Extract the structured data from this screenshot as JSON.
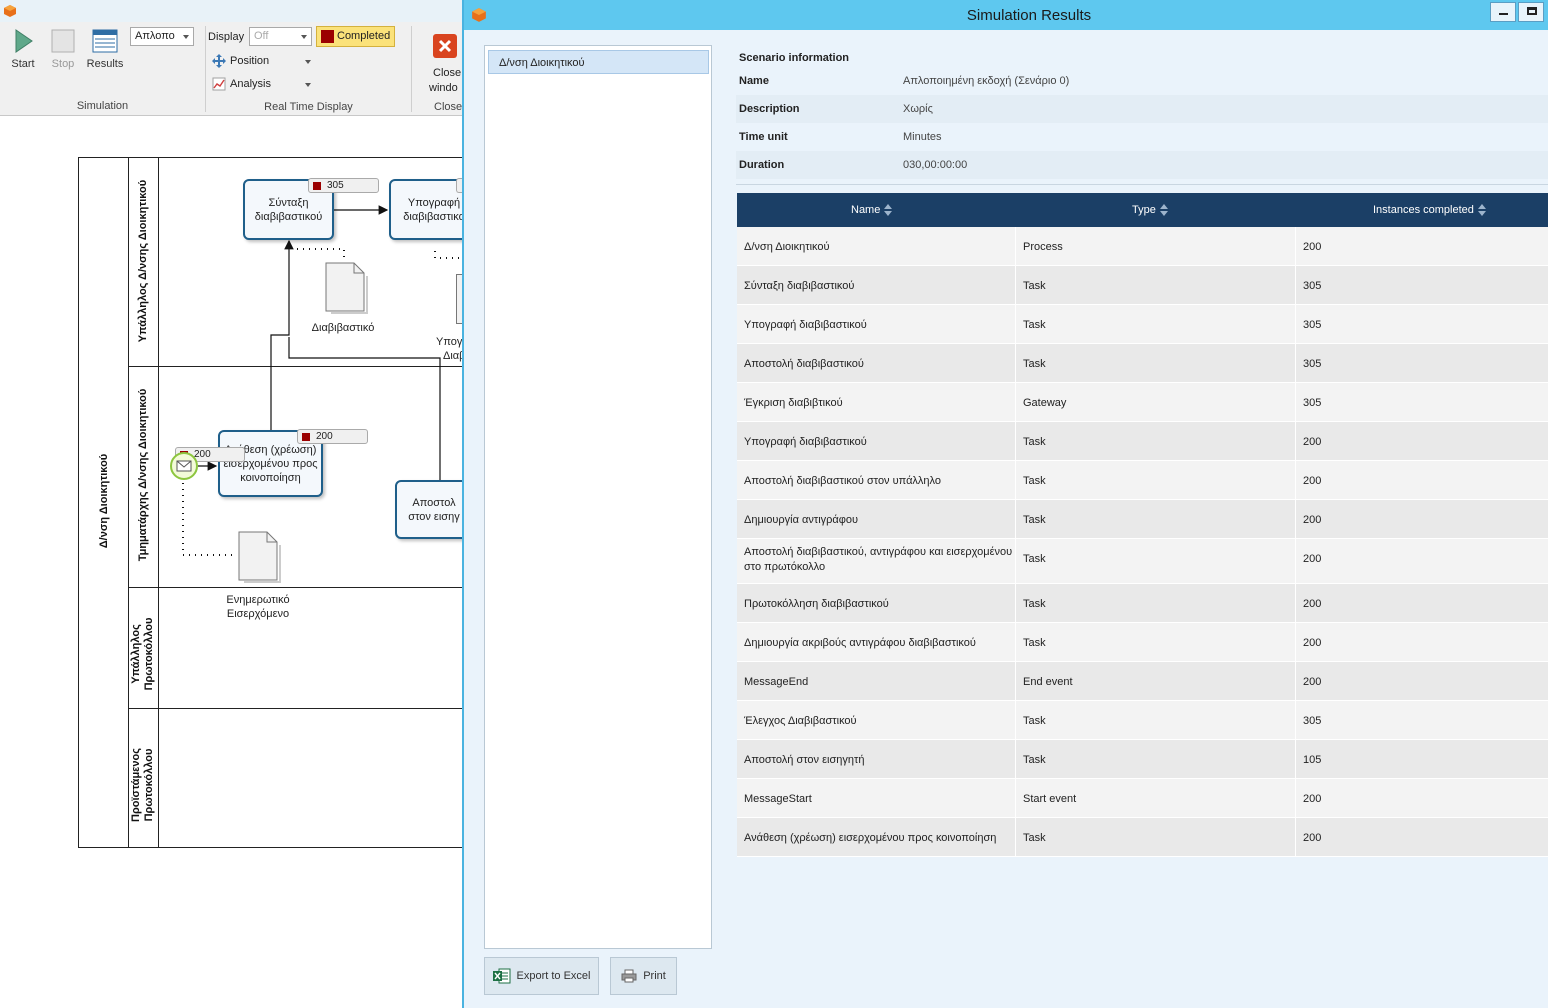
{
  "ribbon": {
    "start_label": "Start",
    "stop_label": "Stop",
    "results_label": "Results",
    "scenario_select": "Απλοπο",
    "display_label": "Display",
    "display_select": "Off",
    "completed_label": "Completed",
    "position_label": "Position",
    "analysis_label": "Analysis",
    "close_label_1": "Close",
    "close_label_2": "windo",
    "group_simulation": "Simulation",
    "group_realtime": "Real Time Display",
    "group_close": "Close"
  },
  "diagram": {
    "pool_label": "Δ/νση Διοικητικού",
    "lanes": [
      "Υπάλληλος Δ/νσης Διοικητικού",
      "Τμηματάρχης Δ/νσης Διοικητικού",
      "Υπάλληλος Πρωτοκόλλου",
      "Προϊστάμενος Πρωτοκόλλου"
    ],
    "tasks": {
      "t1": "Σύνταξη διαβιβαστικού",
      "t2": "Υπογραφή διαβιβαστικο",
      "t3": "Ανάθεση (χρέωση) εισερχομένου προς κοινοποίηση",
      "t4": "Αποστολ στον εισηγ"
    },
    "counters": {
      "c1": "305",
      "c2": "200",
      "c3": "200"
    },
    "docs": {
      "d1": "Διαβιβαστικό",
      "d2a": "Ενημερωτικό",
      "d2b": "Εισερχόμενο",
      "d3a": "Υπογ",
      "d3b": "Διαβ"
    }
  },
  "window": {
    "title": "Simulation Results",
    "tree_item": "Δ/νση Διοικητικού",
    "export_label": "Export to Excel",
    "print_label": "Print"
  },
  "scenario": {
    "title": "Scenario information",
    "rows": [
      {
        "key": "Name",
        "value": "Απλοποιημένη εκδοχή (Σενάριο 0)"
      },
      {
        "key": "Description",
        "value": "Χωρίς"
      },
      {
        "key": "Time unit",
        "value": "Minutes"
      },
      {
        "key": "Duration",
        "value": "030,00:00:00"
      }
    ]
  },
  "table": {
    "headers": [
      "Name",
      "Type",
      "Instances completed"
    ],
    "rows": [
      {
        "name": "Δ/νση Διοικητικού",
        "type": "Process",
        "count": "200"
      },
      {
        "name": "Σύνταξη διαβιβαστικού",
        "type": "Task",
        "count": "305"
      },
      {
        "name": "Υπογραφή διαβιβαστικού",
        "type": "Task",
        "count": "305"
      },
      {
        "name": "Αποστολή διαβιβαστικού",
        "type": "Task",
        "count": "305"
      },
      {
        "name": "Έγκριση διαβιβτικού",
        "type": "Gateway",
        "count": "305"
      },
      {
        "name": "Υπογραφή διαβιβαστικού",
        "type": "Task",
        "count": "200"
      },
      {
        "name": "Αποστολή διαβιβαστικού στον υπάλληλο",
        "type": "Task",
        "count": "200"
      },
      {
        "name": "Δημιουργία αντιγράφου",
        "type": "Task",
        "count": "200"
      },
      {
        "name": "Αποστολή διαβιβαστικού, αντιγράφου και εισερχομένου στο πρωτόκολλο",
        "type": "Task",
        "count": "200"
      },
      {
        "name": "Πρωτοκόλληση διαβιβαστικού",
        "type": "Task",
        "count": "200"
      },
      {
        "name": "Δημιουργία ακριβούς αντιγράφου διαβιβαστικού",
        "type": "Task",
        "count": "200"
      },
      {
        "name": "MessageEnd",
        "type": "End event",
        "count": "200"
      },
      {
        "name": "Έλεγχος Διαβιβαστικού",
        "type": "Task",
        "count": "305"
      },
      {
        "name": "Αποστολή στον εισηγητή",
        "type": "Task",
        "count": "105"
      },
      {
        "name": "MessageStart",
        "type": "Start event",
        "count": "200"
      },
      {
        "name": "Ανάθεση (χρέωση) εισερχομένου προς κοινοποίηση",
        "type": "Task",
        "count": "200"
      }
    ]
  }
}
